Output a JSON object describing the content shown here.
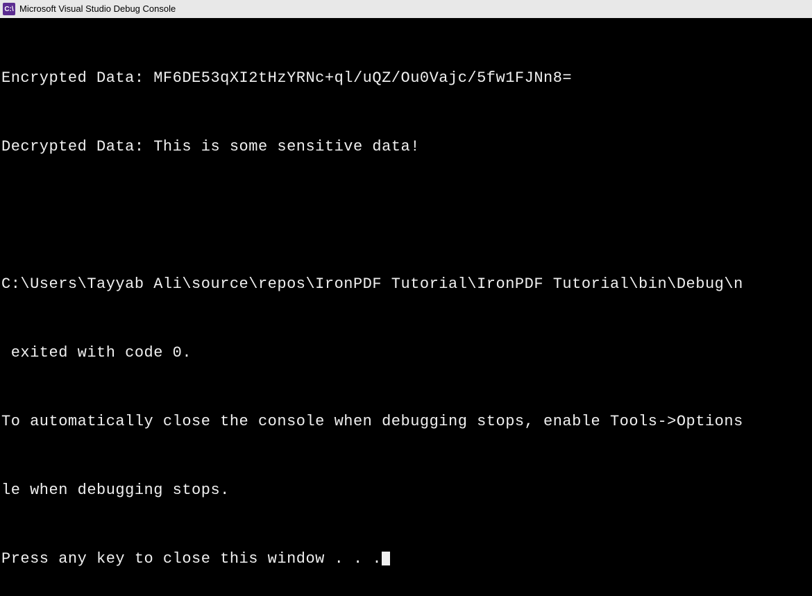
{
  "titlebar": {
    "icon_text": "C:\\",
    "title": "Microsoft Visual Studio Debug Console"
  },
  "console": {
    "lines": [
      "Encrypted Data: MF6DE53qXI2tHzYRNc+ql/uQZ/Ou0Vajc/5fw1FJNn8=",
      "Decrypted Data: This is some sensitive data!",
      "",
      "C:\\Users\\Tayyab Ali\\source\\repos\\IronPDF Tutorial\\IronPDF Tutorial\\bin\\Debug\\n",
      " exited with code 0.",
      "To automatically close the console when debugging stops, enable Tools->Options",
      "le when debugging stops.",
      "Press any key to close this window . . ."
    ]
  }
}
